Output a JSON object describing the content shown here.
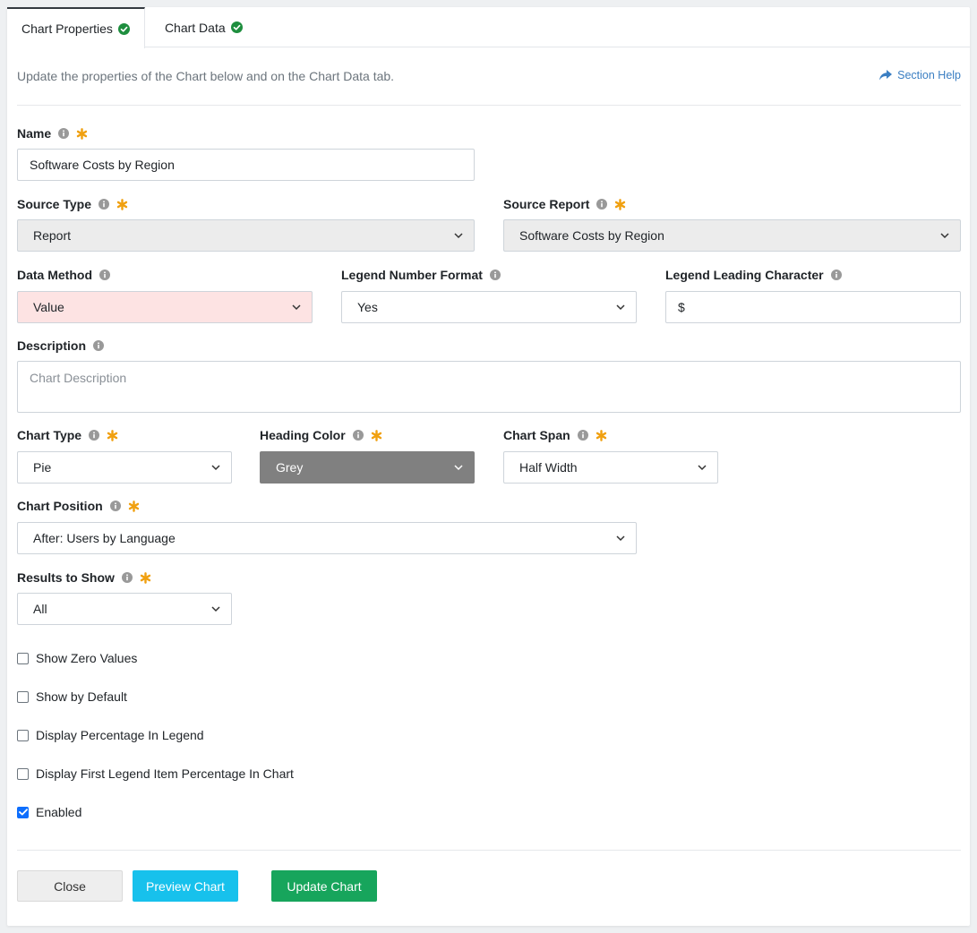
{
  "tabs": [
    {
      "label": "Chart Properties",
      "active": true
    },
    {
      "label": "Chart Data",
      "active": false
    }
  ],
  "intro_text": "Update the properties of the Chart below and on the Chart Data tab.",
  "section_help": "Section Help",
  "fields": {
    "name": {
      "label": "Name",
      "value": "Software Costs by Region"
    },
    "source_type": {
      "label": "Source Type",
      "value": "Report"
    },
    "source_report": {
      "label": "Source Report",
      "value": "Software Costs by Region"
    },
    "data_method": {
      "label": "Data Method",
      "value": "Value"
    },
    "legend_number_format": {
      "label": "Legend Number Format",
      "value": "Yes"
    },
    "legend_leading_character": {
      "label": "Legend Leading Character",
      "value": "$"
    },
    "description": {
      "label": "Description",
      "placeholder": "Chart Description"
    },
    "chart_type": {
      "label": "Chart Type",
      "value": "Pie"
    },
    "heading_color": {
      "label": "Heading Color",
      "value": "Grey"
    },
    "chart_span": {
      "label": "Chart Span",
      "value": "Half Width"
    },
    "chart_position": {
      "label": "Chart Position",
      "value": "After: Users by Language"
    },
    "results_to_show": {
      "label": "Results to Show",
      "value": "All"
    }
  },
  "checkboxes": [
    {
      "label": "Show Zero Values",
      "checked": false
    },
    {
      "label": "Show by Default",
      "checked": false
    },
    {
      "label": "Display Percentage In Legend",
      "checked": false
    },
    {
      "label": "Display First Legend Item Percentage In Chart",
      "checked": false
    },
    {
      "label": "Enabled",
      "checked": true
    }
  ],
  "buttons": {
    "close": "Close",
    "preview": "Preview Chart",
    "update": "Update Chart"
  },
  "colors": {
    "required_star": "#f0a010",
    "success_check": "#1e8e3e",
    "link": "#3a7ec2",
    "preview_button": "#17c1ec",
    "update_button": "#17a55c",
    "heading_color_swatch": "#808080"
  }
}
